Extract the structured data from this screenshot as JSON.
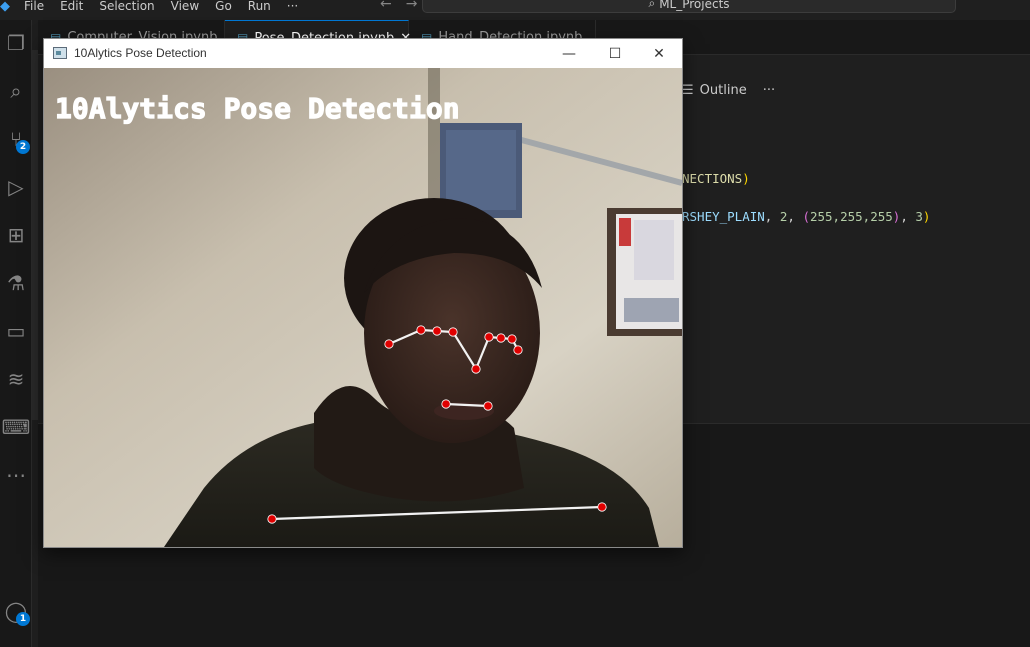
{
  "vscode": {
    "menu": [
      "File",
      "Edit",
      "Selection",
      "View",
      "Go",
      "Run",
      "···"
    ],
    "search_text": "ML_Projects",
    "tabs": [
      {
        "label": "Computer_Vision.ipynb",
        "active": false
      },
      {
        "label": "Pose_Detection.ipynb",
        "active": true
      },
      {
        "label": "Hand_Detection.ipynb",
        "active": false
      }
    ],
    "outline_label": "Outline",
    "outline_more": "···",
    "code_line1_ident": "NECTIONS",
    "code_line1_paren": ")",
    "code_line2_const": "RSHEY_PLAIN",
    "code_line2_sep1": ", ",
    "code_line2_num1": "2",
    "code_line2_sep2": ", ",
    "code_line2_rgb_open": "(",
    "code_line2_rgb": "255,255,255",
    "code_line2_rgb_close": ")",
    "code_line2_sep3": ", ",
    "code_line2_num2": "3",
    "code_line2_close": ")",
    "badges": {
      "source_control": "2",
      "accounts": "1"
    },
    "accent_color": "#0078d4"
  },
  "cv_window": {
    "title": "10Alytics Pose Detection",
    "overlay_text": "10Alytics Pose Detection",
    "controls": {
      "minimize": "—",
      "maximize": "☐",
      "close": "✕"
    },
    "landmark_color": "#e00000",
    "connection_color": "#f2f2f2"
  }
}
